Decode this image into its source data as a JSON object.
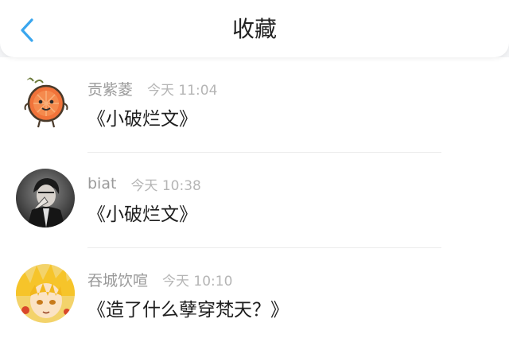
{
  "header": {
    "title": "收藏",
    "back_icon": "chevron-left-icon",
    "accent": "#3aa6ee"
  },
  "items": [
    {
      "name": "贡紫菱",
      "time": "今天 11:04",
      "text": "《小破烂文》",
      "avatar": "orange-cartoon-avatar"
    },
    {
      "name": "biat",
      "time": "今天 10:38",
      "text": "《小破烂文》",
      "avatar": "dark-portrait-avatar"
    },
    {
      "name": "吞城饮喧",
      "time": "今天 10:10",
      "text": "《造了什么孽穿梵天？》",
      "avatar": "blonde-anime-avatar"
    }
  ]
}
